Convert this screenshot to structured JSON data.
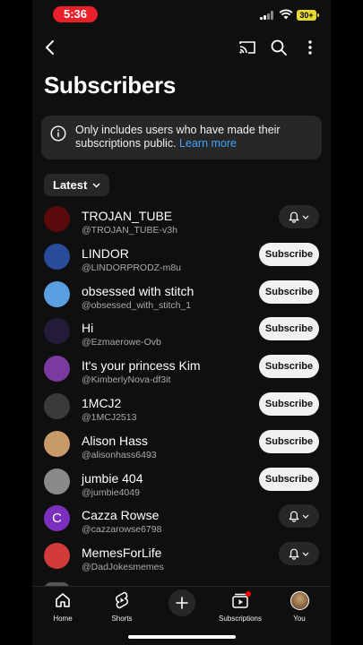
{
  "status": {
    "time": "5:36",
    "battery": "30+"
  },
  "header": {
    "title": "Subscribers",
    "icons": [
      "back-arrow-icon",
      "cast-icon",
      "search-icon",
      "more-vertical-icon"
    ]
  },
  "info": {
    "text": "Only includes users who have made their subscriptions public.",
    "link": "Learn more"
  },
  "filter": {
    "label": "Latest"
  },
  "subscribers": [
    {
      "name": "TROJAN_TUBE",
      "handle": "@TROJAN_TUBE-v3h",
      "action": "bell",
      "avatar_color": "#5a0a0a",
      "initial": ""
    },
    {
      "name": "LINDOR",
      "handle": "@LINDORPRODZ-m8u",
      "action": "subscribe",
      "avatar_color": "#2a4a9a",
      "initial": ""
    },
    {
      "name": "obsessed with stitch",
      "handle": "@obsessed_with_stitch_1",
      "action": "subscribe",
      "avatar_color": "#5aa0e0",
      "initial": ""
    },
    {
      "name": "Hi",
      "handle": "@Ezmaerowe-Ovb",
      "action": "subscribe",
      "avatar_color": "#241a3a",
      "initial": ""
    },
    {
      "name": "It's your princess Kim",
      "handle": "@KimberlyNova-df3it",
      "action": "subscribe",
      "avatar_color": "#7a3aa0",
      "initial": ""
    },
    {
      "name": "1MCJ2",
      "handle": "@1MCJ2513",
      "action": "subscribe",
      "avatar_color": "#3a3a3a",
      "initial": ""
    },
    {
      "name": "Alison Hass",
      "handle": "@alisonhass6493",
      "action": "subscribe",
      "avatar_color": "#c89a6a",
      "initial": ""
    },
    {
      "name": "jumbie 404",
      "handle": "@jumbie4049",
      "action": "subscribe",
      "avatar_color": "#8a8a8a",
      "initial": ""
    },
    {
      "name": "Cazza Rowse",
      "handle": "@cazzarowse6798",
      "action": "bell",
      "avatar_color": "#7b2fbe",
      "initial": "C"
    },
    {
      "name": "MemesForLife",
      "handle": "@DadJokesmemes",
      "action": "bell",
      "avatar_color": "#d33a3a",
      "initial": ""
    }
  ],
  "subscribe_label": "Subscribe",
  "nav": {
    "home": "Home",
    "shorts": "Shorts",
    "subscriptions": "Subscriptions",
    "you": "You"
  }
}
